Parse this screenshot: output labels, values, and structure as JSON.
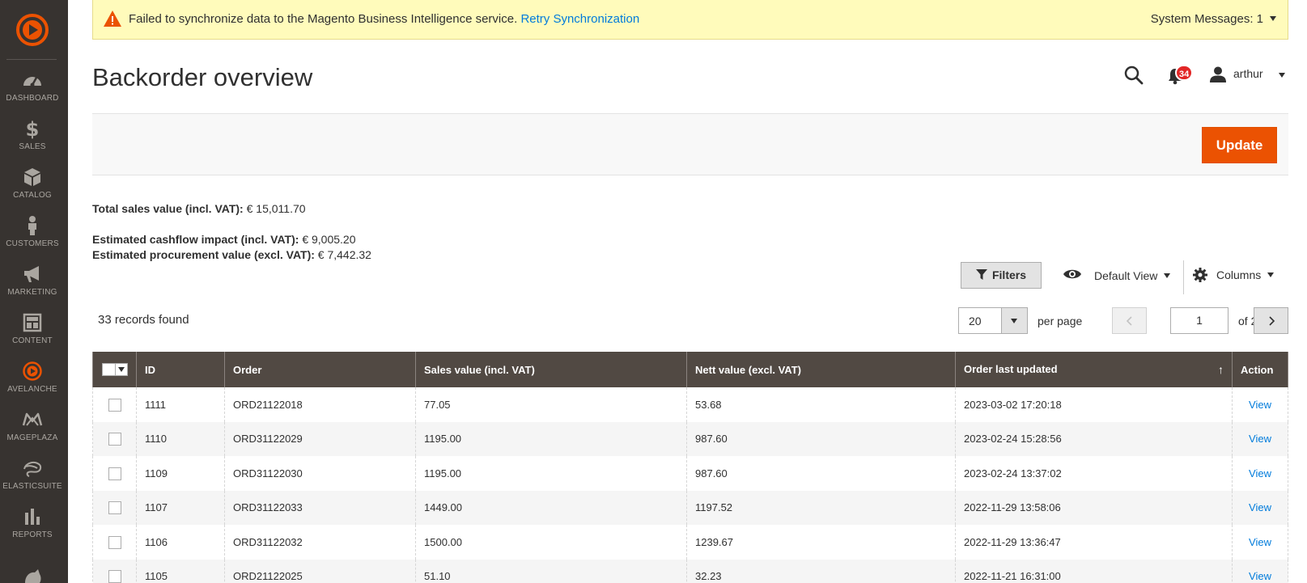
{
  "sidebar": {
    "items": [
      {
        "label": "DASHBOARD",
        "icon": "dashboard-icon"
      },
      {
        "label": "SALES",
        "icon": "dollar-icon"
      },
      {
        "label": "CATALOG",
        "icon": "box-icon"
      },
      {
        "label": "CUSTOMERS",
        "icon": "person-icon"
      },
      {
        "label": "MARKETING",
        "icon": "megaphone-icon"
      },
      {
        "label": "CONTENT",
        "icon": "layout-icon"
      },
      {
        "label": "AVELANCHE",
        "icon": "play-circle-icon"
      },
      {
        "label": "MAGEPLAZA",
        "icon": "mageplaza-icon"
      },
      {
        "label": "ELASTICSUITE",
        "icon": "elasticsuite-icon"
      },
      {
        "label": "REPORTS",
        "icon": "bar-chart-icon"
      }
    ]
  },
  "message": {
    "text": "Failed to synchronize data to the Magento Business Intelligence service.",
    "link": "Retry Synchronization",
    "system_messages": "System Messages: 1"
  },
  "header": {
    "title": "Backorder overview",
    "notifications": "34",
    "user": "arthur"
  },
  "actions": {
    "update_label": "Update"
  },
  "totals": {
    "sales_label": "Total sales value (incl. VAT):",
    "sales_value": "€ 15,011.70",
    "cashflow_label": "Estimated cashflow impact (incl. VAT):",
    "cashflow_value": "€ 9,005.20",
    "procurement_label": "Estimated procurement value (excl. VAT):",
    "procurement_value": "€ 7,442.32"
  },
  "controls": {
    "filters_label": "Filters",
    "view_label": "Default View",
    "columns_label": "Columns",
    "records": "33 records found",
    "per_page_value": "20",
    "per_page_label": "per page",
    "page_value": "1",
    "page_of": "of 2"
  },
  "table": {
    "headers": [
      "ID",
      "Order",
      "Sales value (incl. VAT)",
      "Nett value (excl. VAT)",
      "Order last updated",
      "Action"
    ],
    "rows": [
      {
        "id": "1111",
        "order": "ORD21122018",
        "sales": "77.05",
        "nett": "53.68",
        "updated": "2023-03-02 17:20:18",
        "action": "View"
      },
      {
        "id": "1110",
        "order": "ORD31122029",
        "sales": "1195.00",
        "nett": "987.60",
        "updated": "2023-02-24 15:28:56",
        "action": "View"
      },
      {
        "id": "1109",
        "order": "ORD31122030",
        "sales": "1195.00",
        "nett": "987.60",
        "updated": "2023-02-24 13:37:02",
        "action": "View"
      },
      {
        "id": "1107",
        "order": "ORD31122033",
        "sales": "1449.00",
        "nett": "1197.52",
        "updated": "2022-11-29 13:58:06",
        "action": "View"
      },
      {
        "id": "1106",
        "order": "ORD31122032",
        "sales": "1500.00",
        "nett": "1239.67",
        "updated": "2022-11-29 13:36:47",
        "action": "View"
      },
      {
        "id": "1105",
        "order": "ORD21122025",
        "sales": "51.10",
        "nett": "32.23",
        "updated": "2022-11-21 16:31:00",
        "action": "View"
      }
    ]
  },
  "colors": {
    "sidebar_bg": "#373330",
    "accent": "#eb5202",
    "table_header_bg": "#514943",
    "link": "#007bdb",
    "message_bg": "#fffbbb"
  }
}
